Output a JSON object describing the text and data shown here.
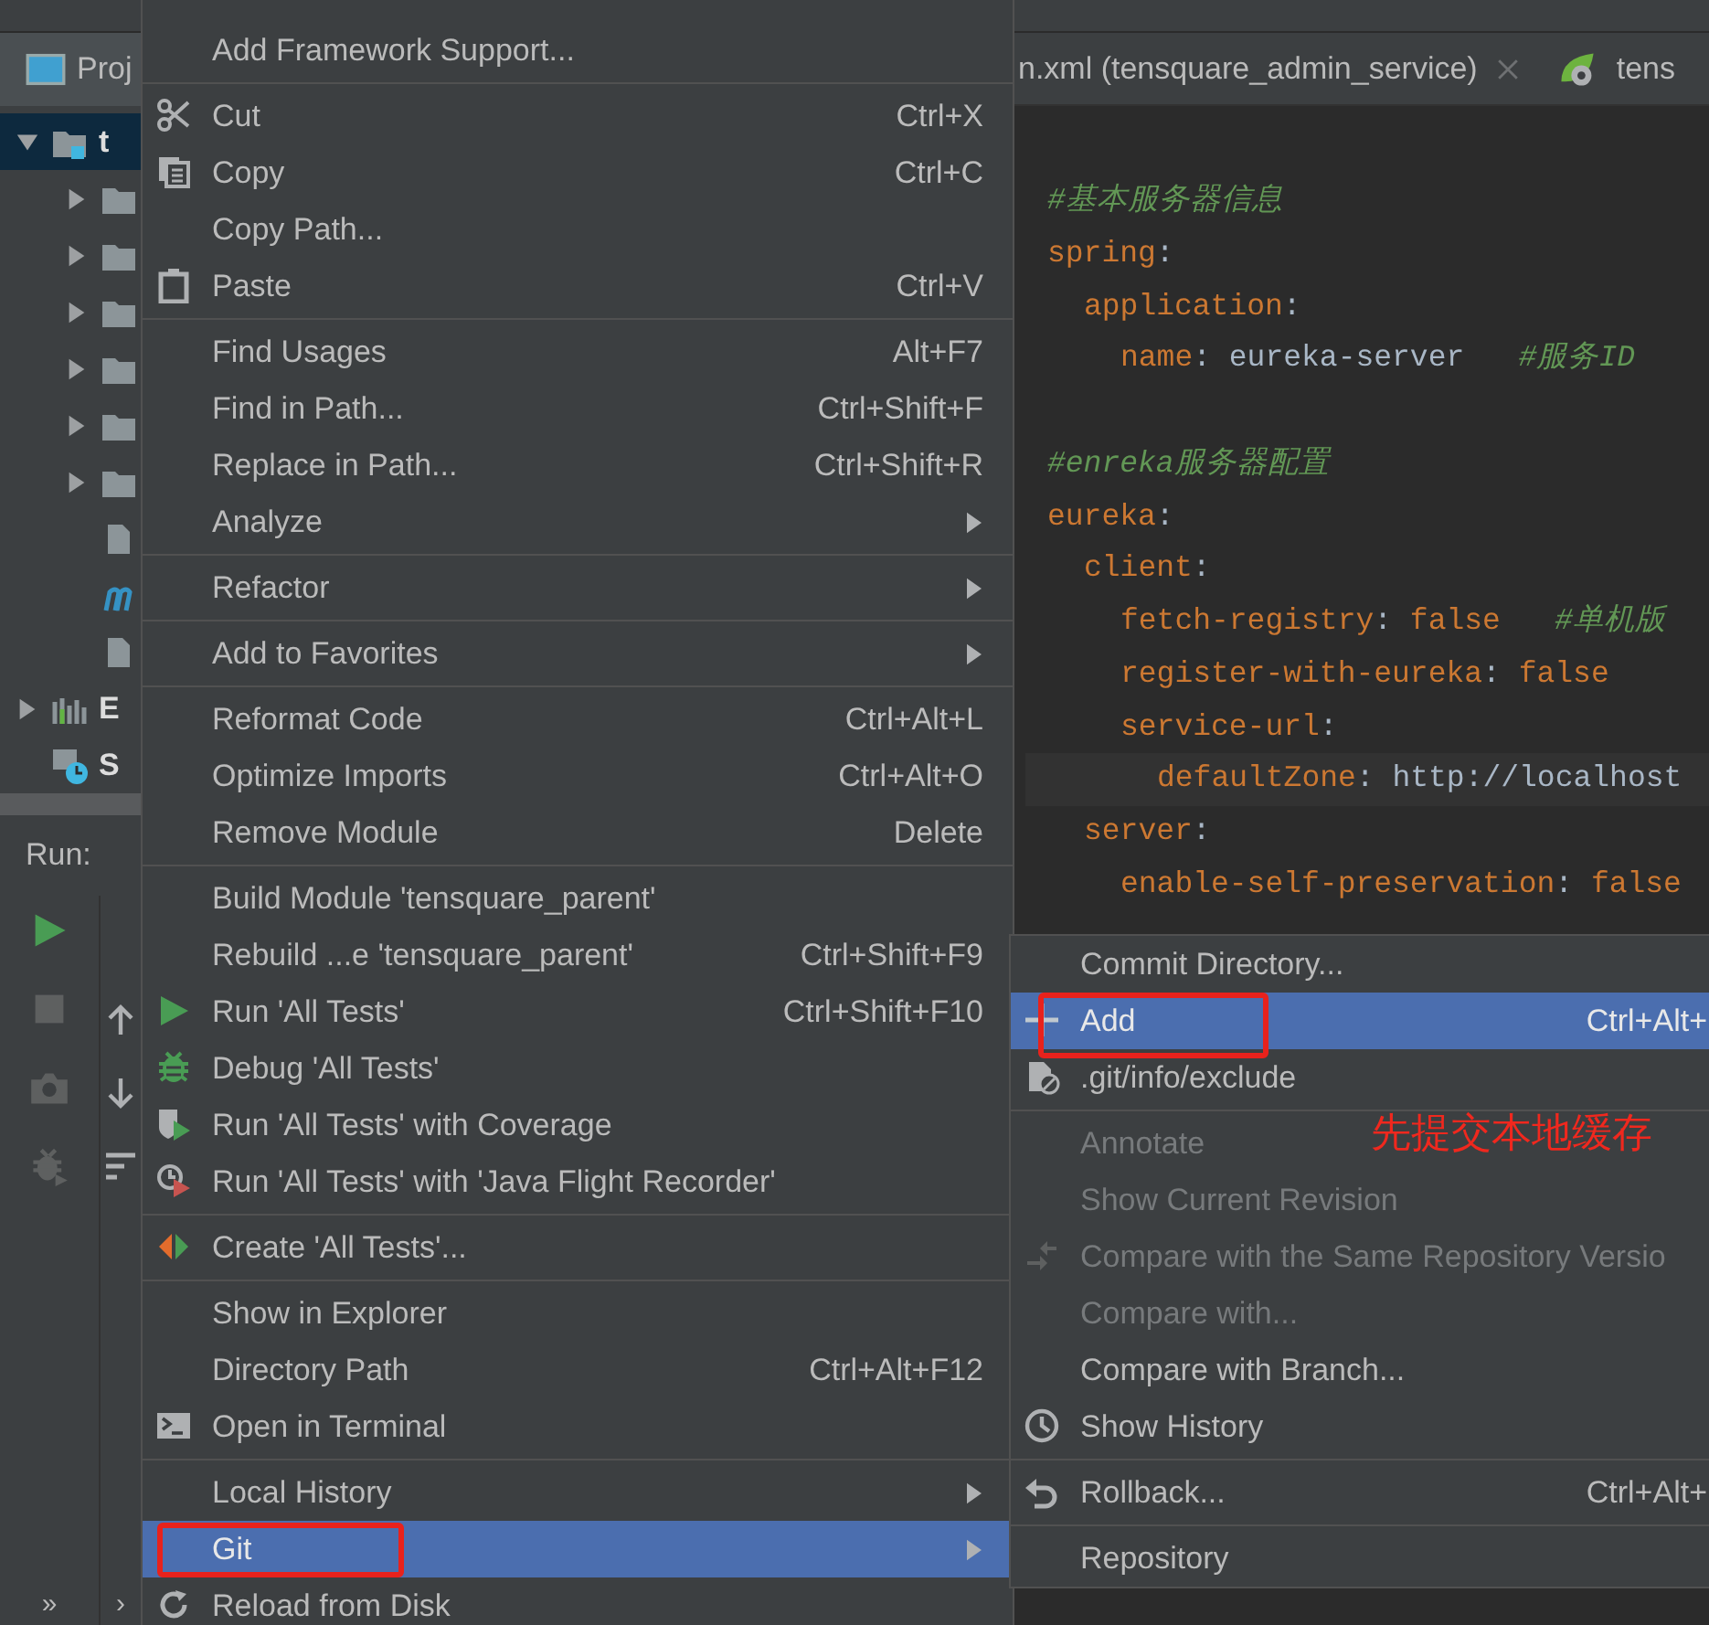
{
  "project_panel": {
    "tab": "Proj",
    "tree": [
      {
        "label": "t",
        "kind": "module",
        "selected": true,
        "expanded": true,
        "children": [
          {
            "kind": "folder",
            "expanded": false
          },
          {
            "kind": "folder",
            "expanded": false
          },
          {
            "kind": "folder",
            "expanded": false
          },
          {
            "kind": "folder",
            "expanded": false
          },
          {
            "kind": "folder",
            "expanded": false
          },
          {
            "kind": "folder",
            "expanded": false
          },
          {
            "kind": "file"
          },
          {
            "kind": "config"
          },
          {
            "kind": "file"
          }
        ]
      },
      {
        "label": "E",
        "kind": "libraries",
        "selected": false,
        "expanded": false
      },
      {
        "label": "S",
        "kind": "scratches",
        "selected": false
      }
    ]
  },
  "run_panel": {
    "title": "Run:",
    "toolbar": [
      {
        "kind": "run"
      },
      {
        "kind": "stop"
      },
      {
        "kind": "camera"
      },
      {
        "kind": "bug"
      }
    ],
    "toolbar_2": [
      {
        "kind": "up"
      },
      {
        "kind": "down"
      },
      {
        "kind": "list"
      }
    ],
    "more": "»",
    "more_2": "›"
  },
  "editor": {
    "tabs": [
      {
        "label": "n.xml (tensquare_admin_service)",
        "kind": "plain",
        "closable": true
      },
      {
        "label": "tens",
        "kind": "spring",
        "closable": false
      }
    ],
    "lines": [
      {
        "tokens": [
          {
            "kind": "comment",
            "text": "#基本服务器信息"
          }
        ]
      },
      {
        "tokens": [
          {
            "kind": "key",
            "text": "spring"
          },
          {
            "kind": "punct",
            "text": ":"
          }
        ],
        "children": [
          {
            "tokens": [
              {
                "kind": "key",
                "text": "application"
              },
              {
                "kind": "punct",
                "text": ":"
              }
            ],
            "children": [
              {
                "tokens": [
                  {
                    "kind": "key",
                    "text": "name"
                  },
                  {
                    "kind": "punct",
                    "text": ":"
                  },
                  {
                    "kind": "value",
                    "text": "eureka-server"
                  },
                  {
                    "kind": "comment",
                    "text": "#服务ID"
                  }
                ]
              }
            ]
          }
        ]
      },
      {
        "blank_before": true,
        "tokens": [
          {
            "kind": "comment",
            "text": "#enreka服务器配置"
          }
        ]
      },
      {
        "tokens": [
          {
            "kind": "key",
            "text": "eureka"
          },
          {
            "kind": "punct",
            "text": ":"
          }
        ],
        "children": [
          {
            "tokens": [
              {
                "kind": "key",
                "text": "client"
              },
              {
                "kind": "punct",
                "text": ":"
              }
            ],
            "children": [
              {
                "tokens": [
                  {
                    "kind": "key",
                    "text": "fetch-registry"
                  },
                  {
                    "kind": "punct",
                    "text": ":"
                  },
                  {
                    "kind": "bool",
                    "text": "false"
                  },
                  {
                    "kind": "comment",
                    "text": "#单机版"
                  }
                ]
              },
              {
                "tokens": [
                  {
                    "kind": "key",
                    "text": "register-with-eureka"
                  },
                  {
                    "kind": "punct",
                    "text": ":"
                  },
                  {
                    "kind": "bool",
                    "text": "false"
                  }
                ]
              },
              {
                "tokens": [
                  {
                    "kind": "key",
                    "text": "service-url"
                  },
                  {
                    "kind": "punct",
                    "text": ":"
                  }
                ],
                "children": [
                  {
                    "current": true,
                    "tokens": [
                      {
                        "kind": "key",
                        "text": "defaultZone"
                      },
                      {
                        "kind": "punct",
                        "text": ":"
                      },
                      {
                        "kind": "value",
                        "text": "http://localhost"
                      }
                    ]
                  }
                ]
              }
            ]
          },
          {
            "tokens": [
              {
                "kind": "key",
                "text": "server"
              },
              {
                "kind": "punct",
                "text": ":"
              }
            ],
            "children": [
              {
                "tokens": [
                  {
                    "kind": "key",
                    "text": "enable-self-preservation"
                  },
                  {
                    "kind": "punct",
                    "text": ":"
                  },
                  {
                    "kind": "bool",
                    "text": "false"
                  }
                ]
              }
            ]
          }
        ]
      }
    ]
  },
  "context_menu": {
    "items": [
      {
        "kind": "plain",
        "label": "Add Framework Support...",
        "selected": false
      },
      {
        "kind": "separator"
      },
      {
        "kind": "scissors",
        "label": "Cut",
        "shortcut": "Ctrl+X",
        "selected": false
      },
      {
        "kind": "copy",
        "label": "Copy",
        "shortcut": "Ctrl+C",
        "selected": false
      },
      {
        "kind": "plain",
        "label": "Copy Path...",
        "selected": false
      },
      {
        "kind": "paste",
        "label": "Paste",
        "shortcut": "Ctrl+V",
        "selected": false
      },
      {
        "kind": "separator"
      },
      {
        "kind": "plain",
        "label": "Find Usages",
        "shortcut": "Alt+F7",
        "selected": false
      },
      {
        "kind": "plain",
        "label": "Find in Path...",
        "shortcut": "Ctrl+Shift+F",
        "selected": false
      },
      {
        "kind": "plain",
        "label": "Replace in Path...",
        "shortcut": "Ctrl+Shift+R",
        "selected": false
      },
      {
        "kind": "plain",
        "label": "Analyze",
        "submenu": true,
        "selected": false
      },
      {
        "kind": "separator"
      },
      {
        "kind": "plain",
        "label": "Refactor",
        "submenu": true,
        "selected": false
      },
      {
        "kind": "separator"
      },
      {
        "kind": "plain",
        "label": "Add to Favorites",
        "submenu": true,
        "selected": false
      },
      {
        "kind": "separator"
      },
      {
        "kind": "plain",
        "label": "Reformat Code",
        "shortcut": "Ctrl+Alt+L",
        "selected": false
      },
      {
        "kind": "plain",
        "label": "Optimize Imports",
        "shortcut": "Ctrl+Alt+O",
        "selected": false
      },
      {
        "kind": "plain",
        "label": "Remove Module",
        "shortcut": "Delete",
        "selected": false
      },
      {
        "kind": "separator"
      },
      {
        "kind": "plain",
        "label": "Build Module 'tensquare_parent'",
        "selected": false
      },
      {
        "kind": "plain",
        "label": "Rebuild ...e 'tensquare_parent'",
        "shortcut": "Ctrl+Shift+F9",
        "selected": false
      },
      {
        "kind": "run",
        "label": "Run 'All Tests'",
        "shortcut": "Ctrl+Shift+F10",
        "selected": false
      },
      {
        "kind": "debug",
        "label": "Debug 'All Tests'",
        "selected": false
      },
      {
        "kind": "coverage",
        "label": "Run 'All Tests' with Coverage",
        "selected": false
      },
      {
        "kind": "recorder",
        "label": "Run 'All Tests' with 'Java Flight Recorder'",
        "selected": false
      },
      {
        "kind": "separator"
      },
      {
        "kind": "create",
        "label": "Create 'All Tests'...",
        "selected": false
      },
      {
        "kind": "separator"
      },
      {
        "kind": "plain",
        "label": "Show in Explorer",
        "selected": false
      },
      {
        "kind": "plain",
        "label": "Directory Path",
        "shortcut": "Ctrl+Alt+F12",
        "selected": false
      },
      {
        "kind": "terminal",
        "label": "Open in Terminal",
        "selected": false
      },
      {
        "kind": "separator"
      },
      {
        "kind": "plain",
        "label": "Local History",
        "submenu": true,
        "selected": false
      },
      {
        "kind": "plain",
        "label": "Git",
        "submenu": true,
        "selected": true,
        "annotated": true
      },
      {
        "kind": "reload",
        "label": "Reload from Disk",
        "selected": false
      }
    ]
  },
  "git_submenu": {
    "items": [
      {
        "kind": "plain",
        "label": "Commit Directory...",
        "selected": false,
        "disabled": false
      },
      {
        "kind": "plus",
        "label": "Add",
        "shortcut": "Ctrl+Alt+",
        "selected": true,
        "disabled": false,
        "annotated": true
      },
      {
        "kind": "exclude",
        "label": ".git/info/exclude",
        "selected": false,
        "disabled": false
      },
      {
        "kind": "separator"
      },
      {
        "kind": "plain",
        "label": "Annotate",
        "selected": false,
        "disabled": true
      },
      {
        "kind": "plain",
        "label": "Show Current Revision",
        "selected": false,
        "disabled": true
      },
      {
        "kind": "compare",
        "label": "Compare with the Same Repository Versio",
        "selected": false,
        "disabled": true
      },
      {
        "kind": "plain",
        "label": "Compare with...",
        "selected": false,
        "disabled": true
      },
      {
        "kind": "plain",
        "label": "Compare with Branch...",
        "selected": false,
        "disabled": false
      },
      {
        "kind": "clock",
        "label": "Show History",
        "selected": false,
        "disabled": false
      },
      {
        "kind": "separator"
      },
      {
        "kind": "rollback",
        "label": "Rollback...",
        "shortcut": "Ctrl+Alt+",
        "selected": false,
        "disabled": false
      },
      {
        "kind": "separator"
      },
      {
        "kind": "plain",
        "label": "Repository",
        "selected": false,
        "disabled": false
      }
    ]
  },
  "annotation": {
    "text": "先提交本地缓存"
  }
}
